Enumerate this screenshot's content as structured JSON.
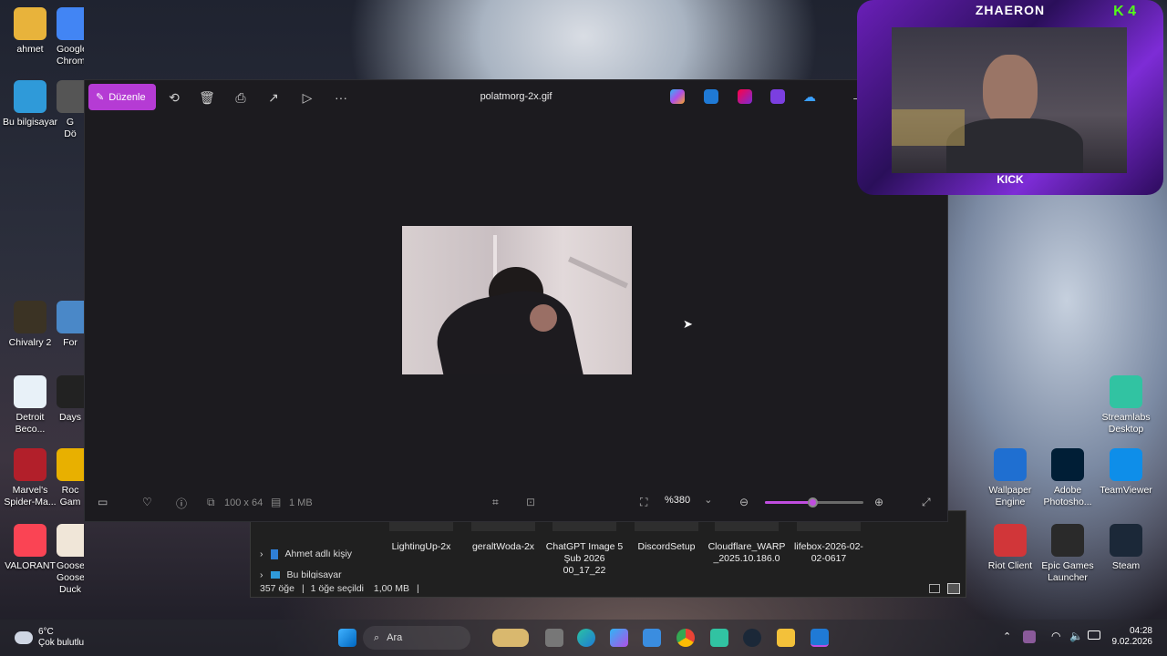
{
  "desktop": {
    "left_icons": [
      {
        "label": "ahmet",
        "icon": "folder-icon",
        "color": "#e8b33b"
      },
      {
        "label": "Google\nChrome",
        "icon": "chrome-icon",
        "color": "#4285f4"
      },
      {
        "label": "Bu bilgisayar",
        "icon": "monitor-icon",
        "color": "#2f9ad9"
      },
      {
        "label": "G\nDö",
        "icon": "partial-icon",
        "color": "#555555"
      },
      {
        "label": "Chivalry 2",
        "icon": "chivalry-icon",
        "color": "#3b3324"
      },
      {
        "label": "For",
        "icon": "partial-icon",
        "color": "#4a88c8"
      },
      {
        "label": "Detroit\nBeco...",
        "icon": "detroit-icon",
        "color": "#e8f1f8"
      },
      {
        "label": "Days",
        "icon": "partial-icon",
        "color": "#222222"
      },
      {
        "label": "Marvel's\nSpider-Ma...",
        "icon": "spiderman-icon",
        "color": "#b21f2a"
      },
      {
        "label": "Roc\nGam",
        "icon": "partial-icon",
        "color": "#e8b000"
      },
      {
        "label": "VALORANT",
        "icon": "valorant-icon",
        "color": "#fa4454"
      },
      {
        "label": "Goose Goose\nDuck",
        "icon": "goose-icon",
        "color": "#f0e6d8"
      }
    ],
    "right_icons": [
      {
        "label": "Streamlabs\nDesktop",
        "icon": "streamlabs-icon",
        "color": "#31c3a2"
      },
      {
        "label": "Wallpaper\nEngine",
        "icon": "wallpaper-engine-icon",
        "color": "#1f6fd1"
      },
      {
        "label": "Adobe\nPhotosho...",
        "icon": "photoshop-icon",
        "color": "#001e36"
      },
      {
        "label": "TeamViewer",
        "icon": "teamviewer-icon",
        "color": "#0e8ee9"
      },
      {
        "label": "Riot Client",
        "icon": "riot-icon",
        "color": "#d13639"
      },
      {
        "label": "Epic Games\nLauncher",
        "icon": "epic-icon",
        "color": "#2a2a2a"
      },
      {
        "label": "Steam",
        "icon": "steam-icon",
        "color": "#1b2838"
      }
    ]
  },
  "explorer": {
    "files": [
      "LightingUp-2x",
      "geraltWoda-2x",
      "ChatGPT Image 5\nŞub 2026\n00_17_22",
      "DiscordSetup",
      "Cloudflare_WARP\n_2025.10.186.0",
      "lifebox-2026-02-\n02-0617"
    ],
    "nav_item": "Ahmet adlı kişiy",
    "nav_item2": "Bu bilgisayar",
    "status": {
      "count": "357 öğe",
      "selected": "1 öğe seçildi",
      "size": "1,00 MB"
    }
  },
  "viewer": {
    "edit_label": "Düzenle",
    "title": "polatmorg-2x.gif",
    "dimensions": "100 x 64",
    "filesize": "1 MB",
    "zoom": "%380",
    "zoom_fraction": 0.48,
    "accent": "#b53bd4"
  },
  "overlay": {
    "name": "ZHAERON",
    "platform": "KICK",
    "badge": "4"
  },
  "taskbar": {
    "weather_temp": "6°C",
    "weather_desc": "Çok bulutlu",
    "search_placeholder": "Ara",
    "time": "04:28",
    "date": "9.02.2026"
  }
}
